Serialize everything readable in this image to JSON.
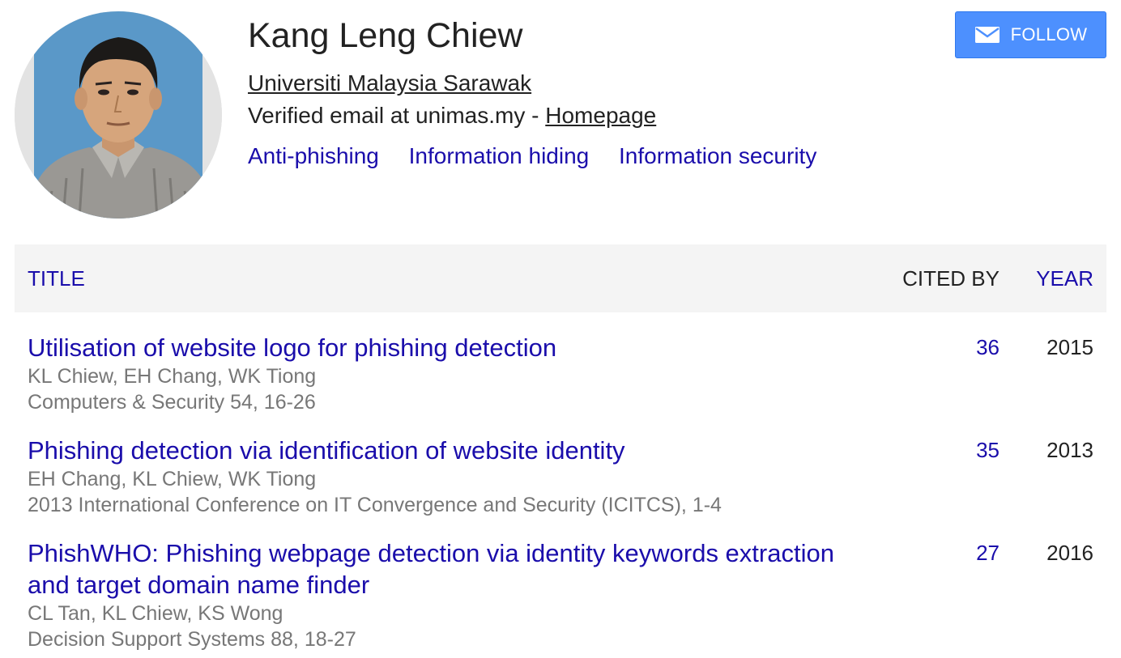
{
  "profile": {
    "name": "Kang Leng Chiew",
    "affiliation": "Universiti Malaysia Sarawak",
    "email_text": "Verified email at unimas.my - ",
    "homepage_label": "Homepage",
    "interests": [
      "Anti-phishing",
      "Information hiding",
      "Information security"
    ]
  },
  "follow_button": {
    "label": "FOLLOW",
    "icon": "mail-icon",
    "color": "#4d90fe"
  },
  "table": {
    "headers": {
      "title": "TITLE",
      "cited_by": "CITED BY",
      "year": "YEAR"
    },
    "rows": [
      {
        "title": "Utilisation of website logo for phishing detection",
        "authors": "KL Chiew, EH Chang, WK Tiong",
        "venue": "Computers & Security 54, 16-26",
        "cited_by": "36",
        "year": "2015"
      },
      {
        "title": "Phishing detection via identification of website identity",
        "authors": "EH Chang, KL Chiew, WK Tiong",
        "venue": "2013 International Conference on IT Convergence and Security (ICITCS), 1-4",
        "cited_by": "35",
        "year": "2013"
      },
      {
        "title": "PhishWHO: Phishing webpage detection via identity keywords extraction and target domain name finder",
        "authors": "CL Tan, KL Chiew, KS Wong",
        "venue": "Decision Support Systems 88, 18-27",
        "cited_by": "27",
        "year": "2016"
      }
    ]
  },
  "colors": {
    "link": "#1a0dab",
    "meta": "#777777",
    "header_bg": "#f4f4f4"
  }
}
